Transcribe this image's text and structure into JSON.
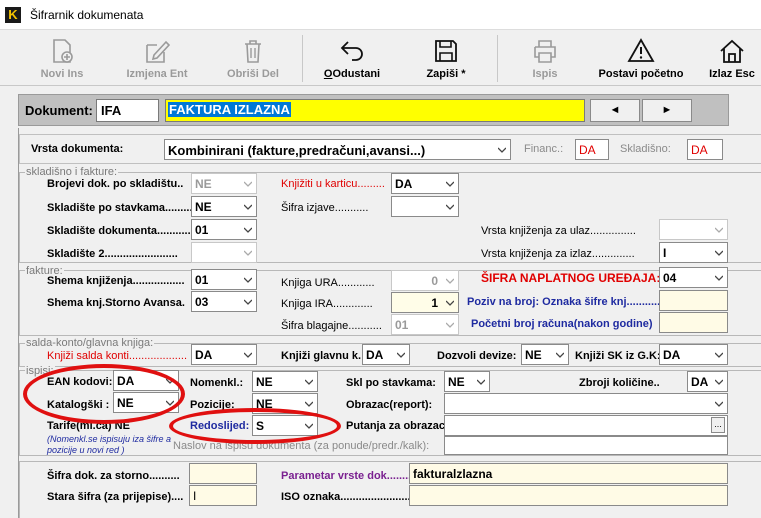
{
  "window": {
    "title": "Šifrarnik dokumenata"
  },
  "toolbar": {
    "novi_ins": "Novi Ins",
    "izmjena_ent": "Izmjena Ent",
    "obrisi_del": "Obriši Del",
    "odustani": "Odustani",
    "zapisi": "Zapiši *",
    "ispis": "Ispis",
    "postavi_pocetno": "Postavi početno",
    "izlaz_esc": "Izlaz Esc"
  },
  "document": {
    "label": "Dokument:",
    "code": "IFA",
    "name": "FAKTURA IZLAZNA",
    "prev": "◄",
    "next": "►"
  },
  "header": {
    "vrsta_label": "Vrsta dokumenta:",
    "vrsta_value": "Kombinirani (fakture,predračuni,avansi...)",
    "financ_label": "Financ.:",
    "financ_value": "DA",
    "skladisno_label": "Skladišno:",
    "skladisno_value": "DA"
  },
  "skladisno": {
    "title": "skladišno i fakture:",
    "brojevi_label": "Brojevi dok. po skladištu..",
    "brojevi_value": "NE",
    "stavkama_label": "Skladište po stavkama.........",
    "stavkama_value": "NE",
    "dokumenta_label": "Skladište dokumenta...........",
    "dokumenta_value": "01",
    "skladiste2_label": "Skladište 2........................",
    "knjiziti_label": "Knjižiti u karticu.........",
    "knjiziti_value": "DA",
    "sifra_izjave_label": "Šifra izjave...........",
    "vrsta_ulaz_label": "Vrsta knjiženja za ulaz...............",
    "vrsta_izlaz_label": "Vrsta knjiženja za izlaz..............",
    "vrsta_izlaz_value": "I"
  },
  "fakture": {
    "title": "fakture:",
    "shema_label": "Shema knjiženja.................",
    "shema_value": "01",
    "storno_label": "Shema knj.Storno Avansa.",
    "storno_value": "03",
    "ura_label": "Knjiga URA............",
    "ura_value": "0",
    "ira_label": "Knjiga IRA.............",
    "ira_value": "1",
    "blagajne_label": "Šifra blagajne...........",
    "blagajne_value": "01",
    "naplatnog_label": "ŠIFRA NAPLATNOG UREĐAJA:",
    "naplatnog_value": "04",
    "poziv_label": "Poziv na broj: Oznaka šifre knj...........",
    "pocetni_label": "Početni broj računa(nakon godine)"
  },
  "salda": {
    "title": "salda-konto/glavna knjiga:",
    "knjizi_salda_label": "Knjiži salda konti...................",
    "knjizi_salda_value": "DA",
    "knjizi_gk_label": "Knjiži glavnu k.:",
    "knjizi_gk_value": "DA",
    "dozvoli_label": "Dozvoli devize:",
    "dozvoli_value": "NE",
    "knjizi_sk_label": "Knjiži SK iz G.K:",
    "knjizi_sk_value": "DA"
  },
  "ispisi": {
    "title": "ispisi:",
    "ean_label": "EAN kodovi:",
    "ean_value": "DA",
    "katalogski_label": "Katalogški :",
    "katalogski_value": "NE",
    "tarife_label": "Tarife(ml.ca) NE",
    "note": "(Nomenkl.se ispisuju iza šifre a pozicije u novi red )",
    "nomenkl_label": "Nomenkl.:",
    "nomenkl_value": "NE",
    "pozicije_label": "Pozicije:",
    "pozicije_value": "NE",
    "redoslijed_label": "Redoslijed:",
    "redoslijed_value": "S",
    "skl_label": "Skl po stavkama:",
    "skl_value": "NE",
    "zbroji_label": "Zbroji količine..",
    "zbroji_value": "DA",
    "obrazac_label": "Obrazac(report):",
    "putanja_label": "Putanja za obrazac",
    "naslov_label": "Naslov na ispisu dokumenta (za ponude/predr./kalk):",
    "browse": "..."
  },
  "bottom": {
    "storno_label": "Šifra dok. za storno..........",
    "stara_label": "Stara šifra (za prijepise)....",
    "stara_value": "I",
    "parametar_label": "Parametar vrste dok...........",
    "parametar_value": "fakturalzlazna",
    "iso_label": "ISO oznaka..........................."
  }
}
